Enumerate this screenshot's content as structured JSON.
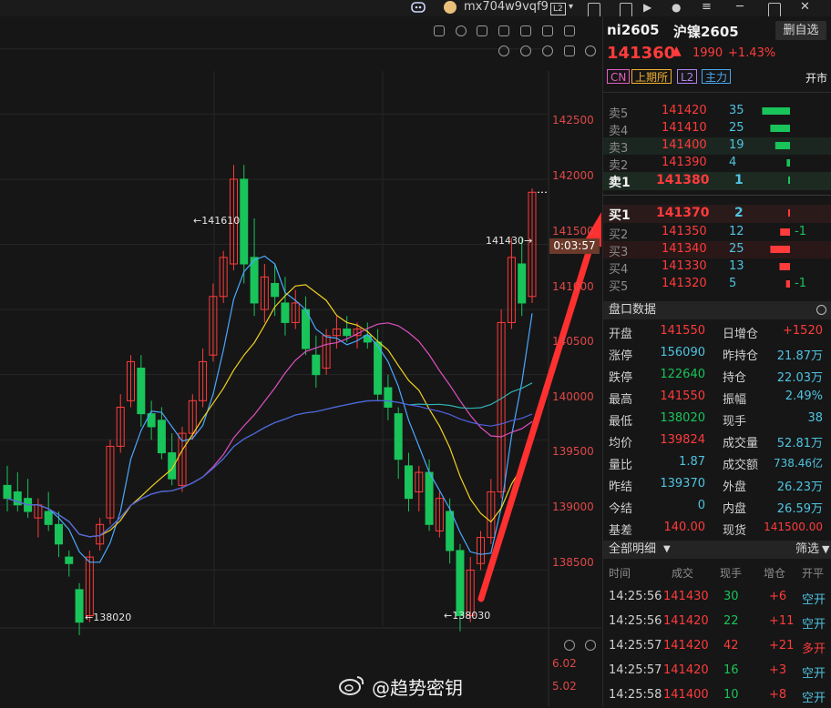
{
  "topbar": {
    "account": "mx704w9vqf9",
    "badge": "L2"
  },
  "chart": {
    "price_ticks": [
      "142500",
      "142000",
      "141500",
      "141000",
      "140500",
      "140000",
      "139500",
      "139000",
      "138500"
    ],
    "sub_ticks": [
      "6.02",
      "5.02"
    ],
    "high_label": "141610",
    "low_label_left": "138020",
    "low_label_right": "138030",
    "last_label": "141430",
    "countdown": "0:03:57"
  },
  "chart_data": {
    "type": "candlestick",
    "ylim": [
      138000,
      142750
    ],
    "ohlc": [
      [
        139150,
        139300,
        138950,
        139050
      ],
      [
        139100,
        139250,
        138950,
        139000
      ],
      [
        139050,
        139200,
        138900,
        138950
      ],
      [
        138900,
        139050,
        138750,
        139000
      ],
      [
        138950,
        139100,
        138800,
        138850
      ],
      [
        138850,
        138950,
        138600,
        138700
      ],
      [
        138600,
        138650,
        138450,
        138550
      ],
      [
        138350,
        138400,
        138000,
        138100
      ],
      [
        138150,
        138650,
        138100,
        138600
      ],
      [
        138700,
        138900,
        138650,
        138850
      ],
      [
        138900,
        139500,
        138850,
        139450
      ],
      [
        139450,
        139850,
        139400,
        139750
      ],
      [
        139800,
        140150,
        139750,
        140100
      ],
      [
        140050,
        140150,
        139600,
        139700
      ],
      [
        139700,
        139800,
        139500,
        139600
      ],
      [
        139650,
        139750,
        139350,
        139400
      ],
      [
        139400,
        139550,
        139150,
        139200
      ],
      [
        139150,
        139600,
        139100,
        139550
      ],
      [
        139550,
        139850,
        139500,
        139800
      ],
      [
        139800,
        140200,
        139750,
        140100
      ],
      [
        140150,
        140700,
        140100,
        140600
      ],
      [
        140600,
        140950,
        140550,
        140900
      ],
      [
        140850,
        141610,
        140800,
        141500
      ],
      [
        141500,
        141610,
        140700,
        140850
      ],
      [
        140900,
        141200,
        140450,
        140550
      ],
      [
        140500,
        140850,
        140400,
        140750
      ],
      [
        140700,
        140850,
        140450,
        140600
      ],
      [
        140550,
        140750,
        140300,
        140400
      ],
      [
        140400,
        140650,
        140350,
        140550
      ],
      [
        140500,
        140600,
        140150,
        140200
      ],
      [
        140150,
        140300,
        139900,
        140000
      ],
      [
        140050,
        140350,
        140000,
        140300
      ],
      [
        140300,
        140450,
        140200,
        140350
      ],
      [
        140350,
        140450,
        140250,
        140300
      ],
      [
        140300,
        140400,
        140200,
        140350
      ],
      [
        140300,
        140400,
        140200,
        140250
      ],
      [
        140250,
        140350,
        139800,
        139850
      ],
      [
        139900,
        140000,
        139650,
        139750
      ],
      [
        139700,
        139750,
        139200,
        139350
      ],
      [
        139300,
        139400,
        138950,
        139050
      ],
      [
        139100,
        139300,
        138950,
        139250
      ],
      [
        139250,
        139350,
        138800,
        138850
      ],
      [
        138800,
        139100,
        138750,
        139050
      ],
      [
        138950,
        139050,
        138550,
        138650
      ],
      [
        138650,
        138700,
        138030,
        138150
      ],
      [
        138150,
        138600,
        138100,
        138500
      ],
      [
        138550,
        138800,
        138500,
        138750
      ],
      [
        138750,
        139200,
        138700,
        139100
      ],
      [
        139100,
        140500,
        139050,
        140400
      ],
      [
        140400,
        141050,
        140350,
        140900
      ],
      [
        140850,
        141050,
        140450,
        140550
      ],
      [
        140600,
        141430,
        140550,
        141400
      ]
    ]
  },
  "panel": {
    "code": "ni2605",
    "name": "沪镍2605",
    "remove_btn": "删自选",
    "price": "141360",
    "change": "1990",
    "change_pct": "+1.43%",
    "tags": [
      "CN",
      "上期所",
      "L2",
      "主力"
    ],
    "session": "开市",
    "asks": [
      {
        "label": "卖5",
        "price": "141420",
        "vol": "35",
        "bar": 0.85
      },
      {
        "label": "卖4",
        "price": "141410",
        "vol": "25",
        "bar": 0.6
      },
      {
        "label": "卖3",
        "price": "141400",
        "vol": "19",
        "bar": 0.45
      },
      {
        "label": "卖2",
        "price": "141390",
        "vol": "4",
        "bar": 0.1
      },
      {
        "label": "卖1",
        "price": "141380",
        "vol": "1",
        "bar": 0.03
      }
    ],
    "bids": [
      {
        "label": "买1",
        "price": "141370",
        "vol": "2",
        "bar": 0.05,
        "delta": ""
      },
      {
        "label": "买2",
        "price": "141350",
        "vol": "12",
        "bar": 0.3,
        "delta": "-1"
      },
      {
        "label": "买3",
        "price": "141340",
        "vol": "25",
        "bar": 0.6,
        "delta": ""
      },
      {
        "label": "买4",
        "price": "141330",
        "vol": "13",
        "bar": 0.32,
        "delta": ""
      },
      {
        "label": "买5",
        "price": "141320",
        "vol": "5",
        "bar": 0.12,
        "delta": "-1"
      }
    ],
    "quote_title": "盘口数据",
    "stats": [
      [
        "开盘",
        "141550",
        "日增仓",
        "+1520"
      ],
      [
        "涨停",
        "156090",
        "昨持仓",
        "21.87万"
      ],
      [
        "跌停",
        "122640",
        "持仓",
        "22.03万"
      ],
      [
        "最高",
        "141550",
        "振幅",
        "2.49%"
      ],
      [
        "最低",
        "138020",
        "现手",
        "38"
      ],
      [
        "均价",
        "139824",
        "成交量",
        "52.81万"
      ],
      [
        "量比",
        "1.87",
        "成交额",
        "738.46亿"
      ],
      [
        "昨结",
        "139370",
        "外盘",
        "26.23万"
      ],
      [
        "今结",
        "0",
        "内盘",
        "26.59万"
      ],
      [
        "基差",
        "140.00",
        "现货",
        "141500.00"
      ]
    ],
    "trades_title": "全部明细",
    "filter": "筛选",
    "trade_headers": [
      "时间",
      "成交",
      "现手",
      "增仓",
      "开平"
    ],
    "trades": [
      [
        "14:25:56",
        "141430",
        "30",
        "+6",
        "空开"
      ],
      [
        "14:25:56",
        "141420",
        "22",
        "+11",
        "空开"
      ],
      [
        "14:25:57",
        "141420",
        "42",
        "+21",
        "多开"
      ],
      [
        "14:25:57",
        "141420",
        "16",
        "+3",
        "空开"
      ],
      [
        "14:25:58",
        "141400",
        "10",
        "+8",
        "空开"
      ]
    ]
  },
  "watermark": "@趋势密钥"
}
